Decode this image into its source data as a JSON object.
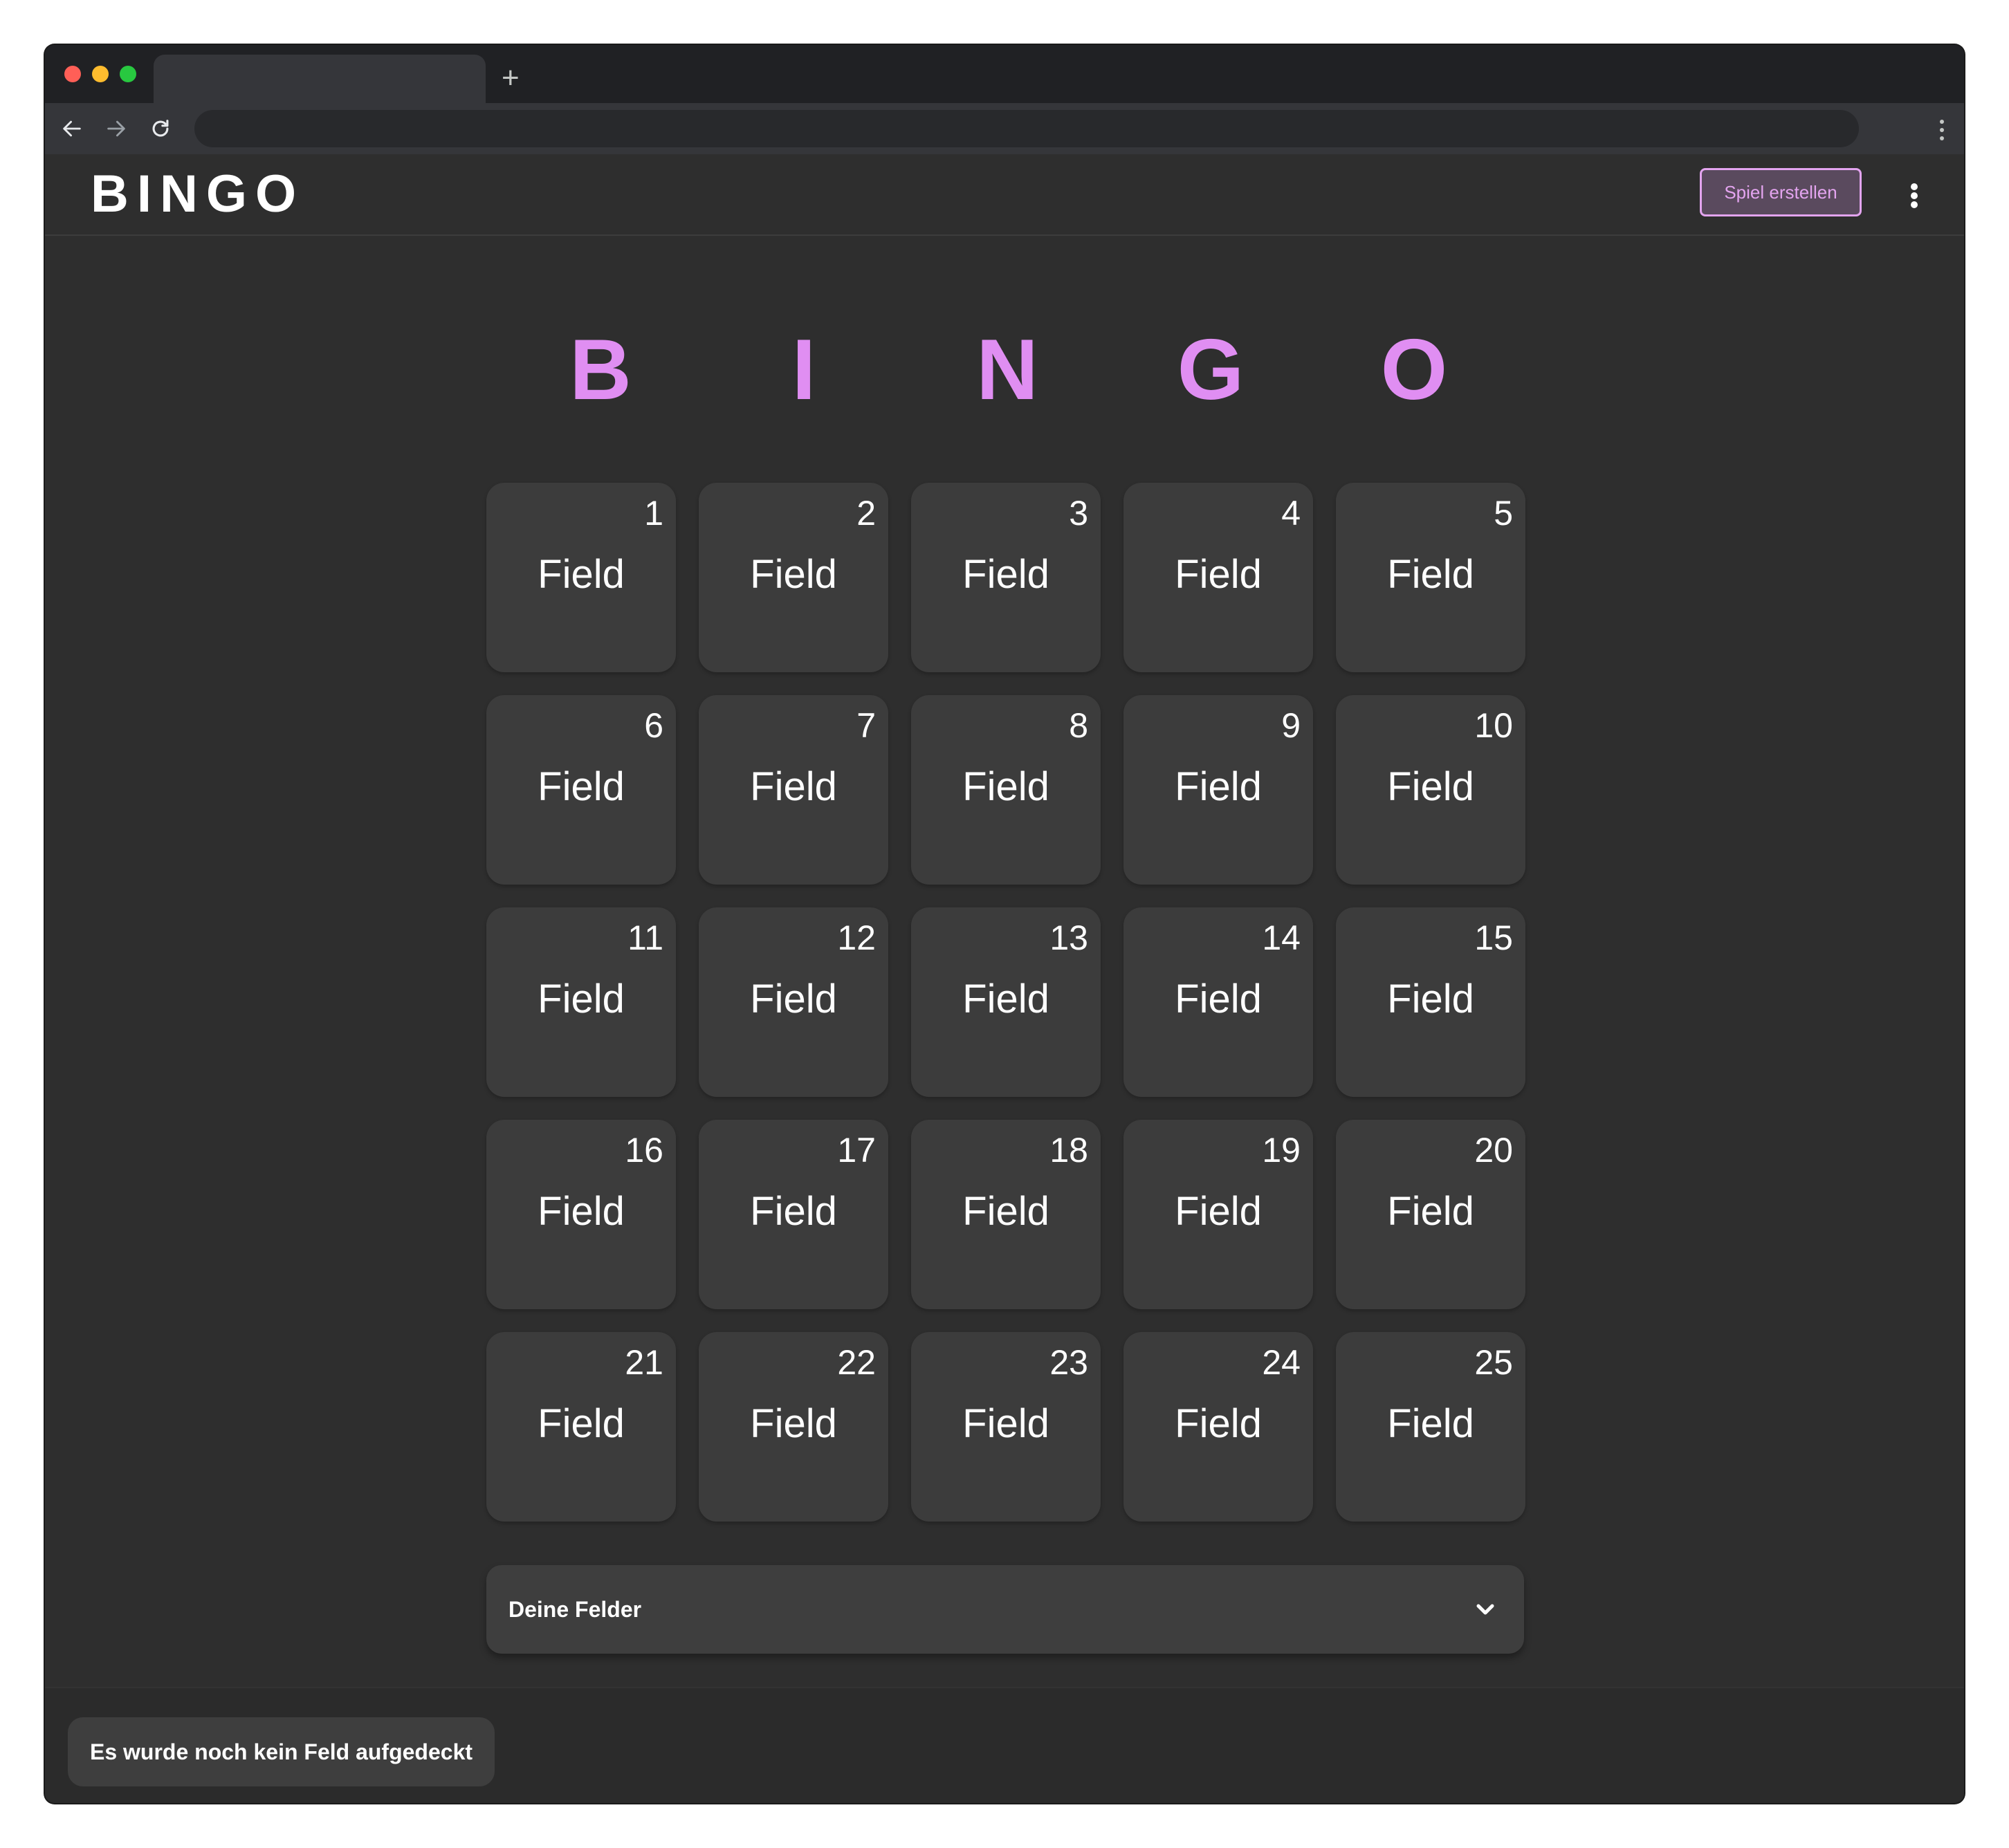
{
  "browser": {
    "new_tab_symbol": "+"
  },
  "app": {
    "logo": "BINGO",
    "create_game_button": "Spiel erstellen",
    "accent_color": "#e08ef2"
  },
  "board": {
    "letters": [
      "B",
      "I",
      "N",
      "G",
      "O"
    ],
    "cells": [
      {
        "number": "1",
        "label": "Field"
      },
      {
        "number": "2",
        "label": "Field"
      },
      {
        "number": "3",
        "label": "Field"
      },
      {
        "number": "4",
        "label": "Field"
      },
      {
        "number": "5",
        "label": "Field"
      },
      {
        "number": "6",
        "label": "Field"
      },
      {
        "number": "7",
        "label": "Field"
      },
      {
        "number": "8",
        "label": "Field"
      },
      {
        "number": "9",
        "label": "Field"
      },
      {
        "number": "10",
        "label": "Field"
      },
      {
        "number": "11",
        "label": "Field"
      },
      {
        "number": "12",
        "label": "Field"
      },
      {
        "number": "13",
        "label": "Field"
      },
      {
        "number": "14",
        "label": "Field"
      },
      {
        "number": "15",
        "label": "Field"
      },
      {
        "number": "16",
        "label": "Field"
      },
      {
        "number": "17",
        "label": "Field"
      },
      {
        "number": "18",
        "label": "Field"
      },
      {
        "number": "19",
        "label": "Field"
      },
      {
        "number": "20",
        "label": "Field"
      },
      {
        "number": "21",
        "label": "Field"
      },
      {
        "number": "22",
        "label": "Field"
      },
      {
        "number": "23",
        "label": "Field"
      },
      {
        "number": "24",
        "label": "Field"
      },
      {
        "number": "25",
        "label": "Field"
      }
    ]
  },
  "accordion": {
    "title": "Deine Felder",
    "icon": "chevron-down-icon"
  },
  "footer": {
    "status": "Es wurde noch kein Feld aufgedeckt"
  }
}
